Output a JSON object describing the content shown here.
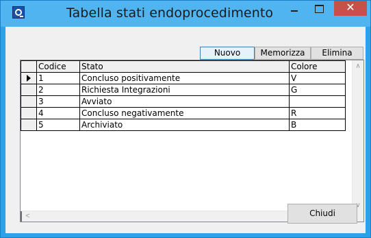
{
  "window": {
    "title": "Tabella stati endoprocedimento",
    "minimize_glyph": "–",
    "maximize_glyph": "☐",
    "close_glyph": "✕",
    "close_color": "#c7504b",
    "titlebar_color": "#4fb4ef"
  },
  "toolbar": {
    "new_label": "Nuovo",
    "save_label": "Memorizza",
    "delete_label": "Elimina"
  },
  "grid": {
    "columns": [
      "Codice",
      "Stato",
      "Colore"
    ],
    "rows": [
      {
        "codice": "1",
        "stato": "Concluso positivamente",
        "colore": "V",
        "current": true
      },
      {
        "codice": "2",
        "stato": "Richiesta Integrazioni",
        "colore": "G",
        "current": false
      },
      {
        "codice": "3",
        "stato": "Avviato",
        "colore": "",
        "current": false
      },
      {
        "codice": "4",
        "stato": "Concluso negativamente",
        "colore": "R",
        "current": false
      },
      {
        "codice": "5",
        "stato": "Archiviato",
        "colore": "B",
        "current": false
      }
    ]
  },
  "footer": {
    "close_label": "Chiudi"
  },
  "icons": {
    "app": "app-logo-icon",
    "row_marker": "current-row-arrow-icon",
    "scroll_up": "chevron-up-icon",
    "scroll_down": "chevron-down-icon",
    "scroll_left": "chevron-left-icon",
    "scroll_right": "chevron-right-icon"
  }
}
